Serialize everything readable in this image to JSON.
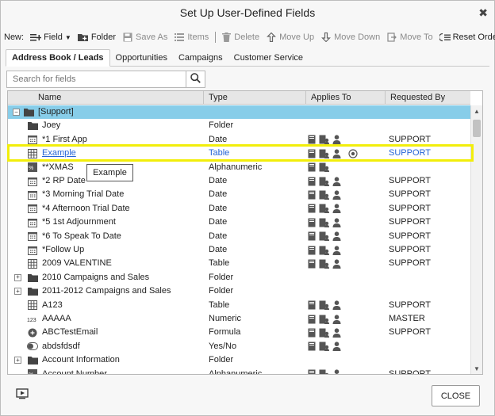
{
  "title": "Set Up User-Defined Fields",
  "toolbar": {
    "new_label": "New:",
    "field": "Field",
    "folder": "Folder",
    "save_as": "Save As",
    "items": "Items",
    "delete": "Delete",
    "move_up": "Move Up",
    "move_down": "Move Down",
    "move_to": "Move To",
    "reset_order": "Reset Order"
  },
  "tabs": [
    "Address Book / Leads",
    "Opportunities",
    "Campaigns",
    "Customer Service"
  ],
  "search": {
    "placeholder": "Search for fields"
  },
  "columns": [
    "Name",
    "Type",
    "Applies To",
    "Requested By"
  ],
  "rows": [
    {
      "name": "[Support]",
      "type": "",
      "requested": "",
      "icon": "folder-icon",
      "expander": "minus",
      "level": 0,
      "applies": []
    },
    {
      "name": "Joey",
      "type": "Folder",
      "requested": "",
      "icon": "folder-icon",
      "level": 1,
      "applies": []
    },
    {
      "name": "*1 First App",
      "type": "Date",
      "requested": "SUPPORT",
      "icon": "calendar-icon",
      "level": 1,
      "applies": [
        "book",
        "lead",
        "person"
      ]
    },
    {
      "name": "Example",
      "type": "Table",
      "requested": "SUPPORT",
      "icon": "table-icon",
      "level": 1,
      "applies": [
        "book",
        "lead",
        "person",
        "target"
      ],
      "link": true
    },
    {
      "name": "**XMAS",
      "type": "Alphanumeric",
      "requested": "",
      "icon": "alphanumeric-icon",
      "level": 1,
      "applies": [
        "book",
        "lead"
      ]
    },
    {
      "name": "*2 RP Date",
      "type": "Date",
      "requested": "SUPPORT",
      "icon": "calendar-icon",
      "level": 1,
      "applies": [
        "book",
        "lead",
        "person"
      ]
    },
    {
      "name": "*3 Morning Trial Date",
      "type": "Date",
      "requested": "SUPPORT",
      "icon": "calendar-icon",
      "level": 1,
      "applies": [
        "book",
        "lead",
        "person"
      ]
    },
    {
      "name": "*4 Afternoon Trial Date",
      "type": "Date",
      "requested": "SUPPORT",
      "icon": "calendar-icon",
      "level": 1,
      "applies": [
        "book",
        "lead",
        "person"
      ]
    },
    {
      "name": "*5 1st Adjournment",
      "type": "Date",
      "requested": "SUPPORT",
      "icon": "calendar-icon",
      "level": 1,
      "applies": [
        "book",
        "lead",
        "person"
      ]
    },
    {
      "name": "*6 To Speak To Date",
      "type": "Date",
      "requested": "SUPPORT",
      "icon": "calendar-icon",
      "level": 1,
      "applies": [
        "book",
        "lead",
        "person"
      ]
    },
    {
      "name": "*Follow Up",
      "type": "Date",
      "requested": "SUPPORT",
      "icon": "calendar-icon",
      "level": 1,
      "applies": [
        "book",
        "lead",
        "person"
      ]
    },
    {
      "name": "2009 VALENTINE",
      "type": "Table",
      "requested": "SUPPORT",
      "icon": "table-icon",
      "level": 1,
      "applies": [
        "book",
        "lead",
        "person"
      ]
    },
    {
      "name": "2010 Campaigns and Sales",
      "type": "Folder",
      "requested": "",
      "icon": "folder-icon",
      "expander": "plus",
      "level": 1,
      "applies": []
    },
    {
      "name": "2011-2012 Campaigns and Sales",
      "type": "Folder",
      "requested": "",
      "icon": "folder-icon",
      "expander": "plus",
      "level": 1,
      "applies": []
    },
    {
      "name": "A123",
      "type": "Table",
      "requested": "SUPPORT",
      "icon": "table-icon",
      "level": 1,
      "applies": [
        "book",
        "lead",
        "person"
      ]
    },
    {
      "name": "AAAAA",
      "type": "Numeric",
      "requested": "MASTER",
      "icon": "numeric-icon",
      "level": 1,
      "applies": [
        "book",
        "lead",
        "person"
      ]
    },
    {
      "name": "ABCTestEmail",
      "type": "Formula",
      "requested": "SUPPORT",
      "icon": "formula-icon",
      "level": 1,
      "applies": [
        "book",
        "lead",
        "person"
      ]
    },
    {
      "name": "abdsfdsdf",
      "type": "Yes/No",
      "requested": "",
      "icon": "toggle-icon",
      "level": 1,
      "applies": [
        "book",
        "lead",
        "person"
      ]
    },
    {
      "name": "Account Information",
      "type": "Folder",
      "requested": "",
      "icon": "folder-icon",
      "expander": "plus",
      "level": 1,
      "applies": []
    },
    {
      "name": "Account Number",
      "type": "Alphanumeric",
      "requested": "SUPPORT",
      "icon": "alphanumeric-icon",
      "level": 1,
      "applies": [
        "book",
        "lead",
        "person"
      ]
    }
  ],
  "tooltip": "Example",
  "footer": {
    "close_label": "CLOSE"
  }
}
